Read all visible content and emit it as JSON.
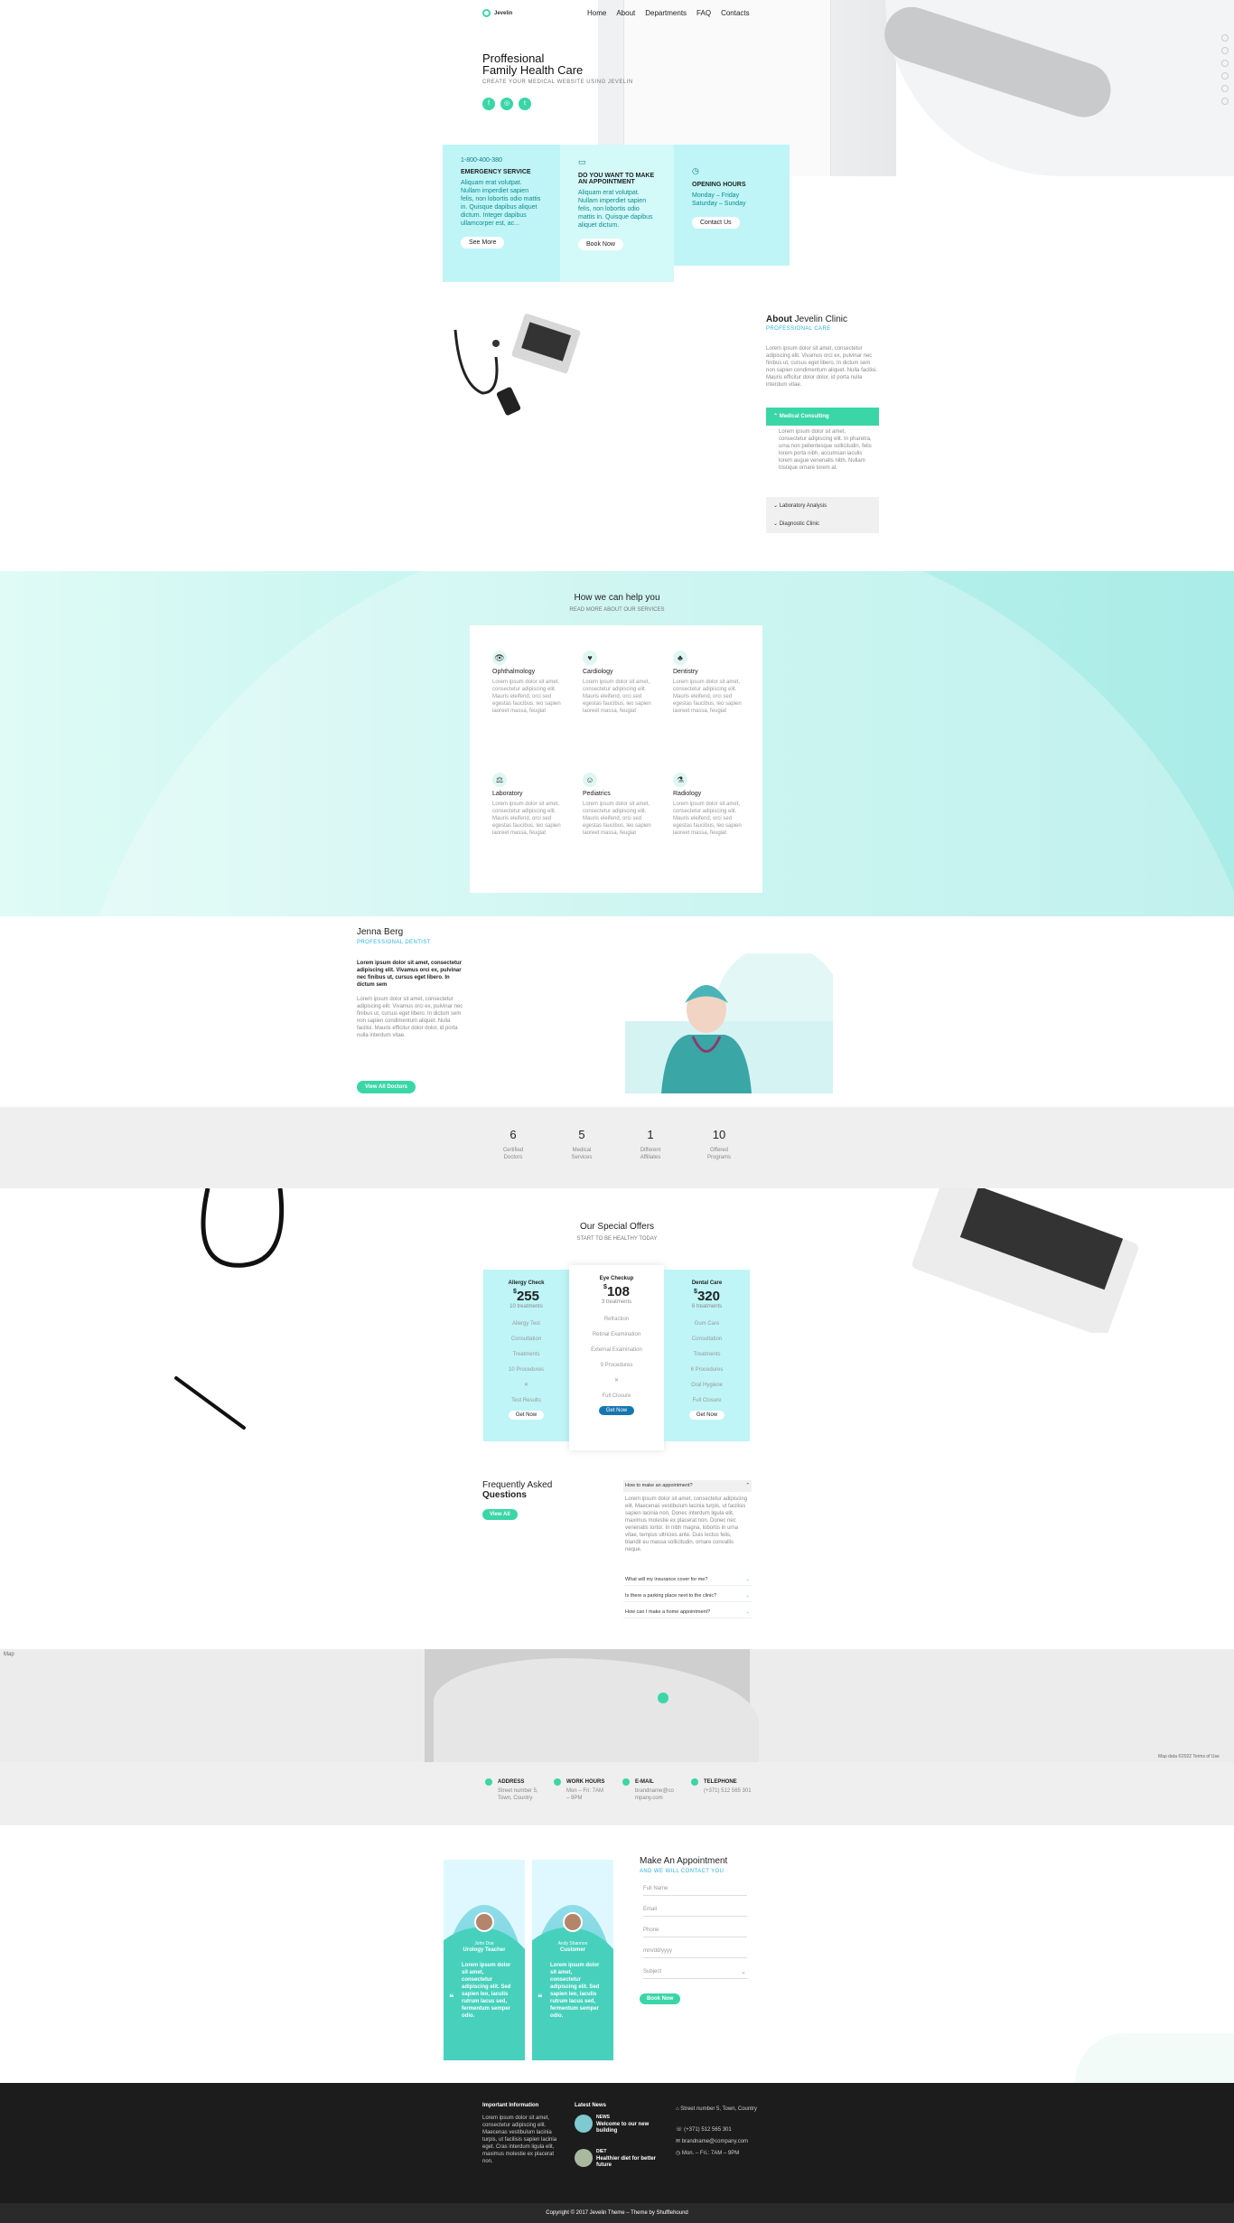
{
  "header": {
    "logo_text": "Jevelin",
    "nav": [
      "Home",
      "About",
      "Departments",
      "FAQ",
      "Contacts"
    ],
    "hero_title_line1": "Proffesional",
    "hero_title_line2": "Family Health Care",
    "hero_sub": "CREATE YOUR MEDICAL WEBSITE USING JEVELIN"
  },
  "cards": {
    "emergency": {
      "phone": "1-800-400-380",
      "title": "EMERGENCY SERVICE",
      "text": "Aliquam erat volutpat. Nullam imperdiet sapien felis, non lobortis odio mattis in. Quisque dapibus aliquet dictum. Integer dapibus ullamcorper est, ac...",
      "button": "See More"
    },
    "appointment": {
      "title": "DO YOU WANT TO MAKE AN APPOINTMENT",
      "text": "Aliquam erat volutpat. Nullam imperdiet sapien felis, non lobortis odio mattis in. Quisque dapibus aliquet dictum.",
      "button": "Book Now"
    },
    "hours": {
      "title": "OPENING HOURS",
      "line1": "Monday – Friday",
      "line2": "Saturday – Sunday",
      "button": "Contact Us"
    }
  },
  "about": {
    "title_prefix": "About",
    "title_name": "Jevelin Clinic",
    "subtitle": "PROFESSIONAL CARE",
    "text": "Lorem ipsum dolor sit amet, consectetur adipiscing elit. Vivamus orci ex, pulvinar nec finibus ut, cursus eget libero. In dictum sem non sapien condimentum aliquet. Nulla facilisi. Mauris efficitur dolor dolor, id porta nulla interdum vitae.",
    "accordion": [
      {
        "label": "Medical Consulting",
        "open": true,
        "text": "Lorem ipsum dolor sit amet, consectetur adipiscing elit. In pharetra, urna non pellentesque sollicitudin, felis lorem porta nibh, accumsan iaculis lorem augue venenatis nibh. Nullam tristique ornare lorem at."
      },
      {
        "label": "Laboratory Analysis",
        "open": false
      },
      {
        "label": "Diagnostic Clinic",
        "open": false
      }
    ]
  },
  "services": {
    "title": "How we can help you",
    "subtitle": "READ MORE ABOUT OUR SERVICES",
    "text": "Lorem ipsum dolor sit amet, consectetur adipiscing elit. Mauris eleifend, orci sed egestas faucibus, leo sapien laoreet massa, feugiat",
    "items": [
      {
        "name": "Ophthalmology",
        "icon": "eye-icon",
        "glyph": "👁"
      },
      {
        "name": "Cardiology",
        "icon": "heart-icon",
        "glyph": "♥"
      },
      {
        "name": "Dentistry",
        "icon": "tooth-icon",
        "glyph": "♣"
      },
      {
        "name": "Laboratory",
        "icon": "scale-icon",
        "glyph": "⚖"
      },
      {
        "name": "Pediatrics",
        "icon": "baby-icon",
        "glyph": "☺"
      },
      {
        "name": "Radiology",
        "icon": "microscope-icon",
        "glyph": "⚗"
      }
    ]
  },
  "doctor": {
    "first": "Jenna",
    "last": "Berg",
    "role": "PROFESSIONAL DENTIST",
    "lead": "Lorem ipsum dolor sit amet, consectetur adipiscing elit. Vivamus orci ex, pulvinar nec finibus ut, cursus eget libero. In dictum sem",
    "text": "Lorem ipsum dolor sit amet, consectetur adipiscing elit. Vivamus orci ex, pulvinar nec finibus ut, cursus eget libero. In dictum sem non sapien condimentum aliquet. Nulla facilisi. Mauris efficitur dolor dolor, id porta nulla interdum vitae.",
    "button": "View All Doctors"
  },
  "stats": [
    {
      "value": "6",
      "label1": "Certified",
      "label2": "Doctors"
    },
    {
      "value": "5",
      "label1": "Medical",
      "label2": "Services"
    },
    {
      "value": "1",
      "label1": "Different",
      "label2": "Affiliates"
    },
    {
      "value": "10",
      "label1": "Offered",
      "label2": "Programs"
    }
  ],
  "offers": {
    "title": "Our Special Offers",
    "subtitle": "START TO BE HEALTHY TODAY",
    "plans": [
      {
        "name": "Allergy Check",
        "currency": "$",
        "price": "255",
        "time": "10 treatments",
        "rows": [
          "Allergy Test",
          "Consultation",
          "Treatments",
          "10 Procedures",
          "✕",
          "Test Results"
        ],
        "button": "Get Now"
      },
      {
        "name": "Eye Checkup",
        "currency": "$",
        "price": "108",
        "time": "3 treatments",
        "rows": [
          "Refraction",
          "Retinal Examination",
          "External Examination",
          "9 Procedures",
          "✕",
          "Full Closure"
        ],
        "button": "Get Now"
      },
      {
        "name": "Dental Care",
        "currency": "$",
        "price": "320",
        "time": "6 treatments",
        "rows": [
          "Gum Care",
          "Consultation",
          "Treatments",
          "6 Procedures",
          "Oral Hygiene",
          "Full Closure"
        ],
        "button": "Get Now"
      }
    ]
  },
  "faq": {
    "title1": "Frequently Asked",
    "title2": "Questions",
    "button": "View All",
    "questions": [
      {
        "q": "How to make an appointment?",
        "open": true,
        "a": "Lorem ipsum dolor sit amet, consectetur adipiscing elit. Maecenas vestibulum lacinia turpis, ut facilisis sapien lacinia non. Donec interdum ligula elit, maximus molestie ex placerat non. Donec nec venenatis tortor. In nibh magna, lobortis in urna vitae, tempus ultricies ante. Duis lectus felis, blandit eu massa sollicitudin, ornare convallis neque."
      },
      {
        "q": "What will my insurance cover for me?",
        "open": false
      },
      {
        "q": "Is there a parking place next to the clinic?",
        "open": false
      },
      {
        "q": "How can I make a home appointment?",
        "open": false
      }
    ]
  },
  "map": {
    "label": "Map",
    "credit": "Map data ©2022 Terms of Use"
  },
  "contact": [
    {
      "title": "ADDRESS",
      "line1": "Street number 5,",
      "line2": "Town, Country"
    },
    {
      "title": "WORK HOURS",
      "line1": "Mon – Fri: 7AM",
      "line2": "– 9PM"
    },
    {
      "title": "E-MAIL",
      "line1": "brandname@co",
      "line2": "mpany.com"
    },
    {
      "title": "TELEPHONE",
      "line1": "(+371) 512 565 301",
      "line2": ""
    }
  ],
  "testimonials": [
    {
      "name": "John Doe",
      "role": "Urology Teacher",
      "quote": "Lorem ipsum dolor sit amet, consectetur adipiscing elit. Sed sapien leo, iaculis rutrum lacus sed, fermentum semper odio."
    },
    {
      "name": "Andy Shannon",
      "role": "Customer",
      "quote": "Lorem ipsum dolor sit amet, consectetur adipiscing elit. Sed sapien leo, iaculis rutrum lacus sed, fermentum semper odio."
    }
  ],
  "appointment": {
    "title": "Make An Appointment",
    "subtitle": "AND WE WILL CONTACT YOU",
    "fields": [
      "Full Name",
      "Email",
      "Phone",
      "mm/dd/yyyy",
      "Subject"
    ],
    "button": "Book Now"
  },
  "footer": {
    "info_title": "Important Information",
    "info_text": "Lorem ipsum dolor sit amet, consectetur adipiscing elit. Maecenas vestibulum lacinia turpis, ut facilisis sapien lacinia eget. Cras interdum ligula elit, maximus molestie ex placerat non.",
    "news_title": "Latest News",
    "news": [
      {
        "tag": "NEWS",
        "title": "Welcome to our new building"
      },
      {
        "tag": "DIET",
        "title": "Healthier diet for better future"
      }
    ],
    "address": "Street number 5, Town, Country",
    "phone": "(+371) 512 565 301",
    "email": "brandname@company.com",
    "hours": "Mon. – Fri.: 7AM – 9PM",
    "copyright": "Copyright © 2017 Jevelin Theme – Theme by Shufflehound"
  },
  "colors": {
    "accent": "#3ad6a8",
    "cyan_card": "#bff5f7",
    "footer": "#1c1c1c"
  }
}
